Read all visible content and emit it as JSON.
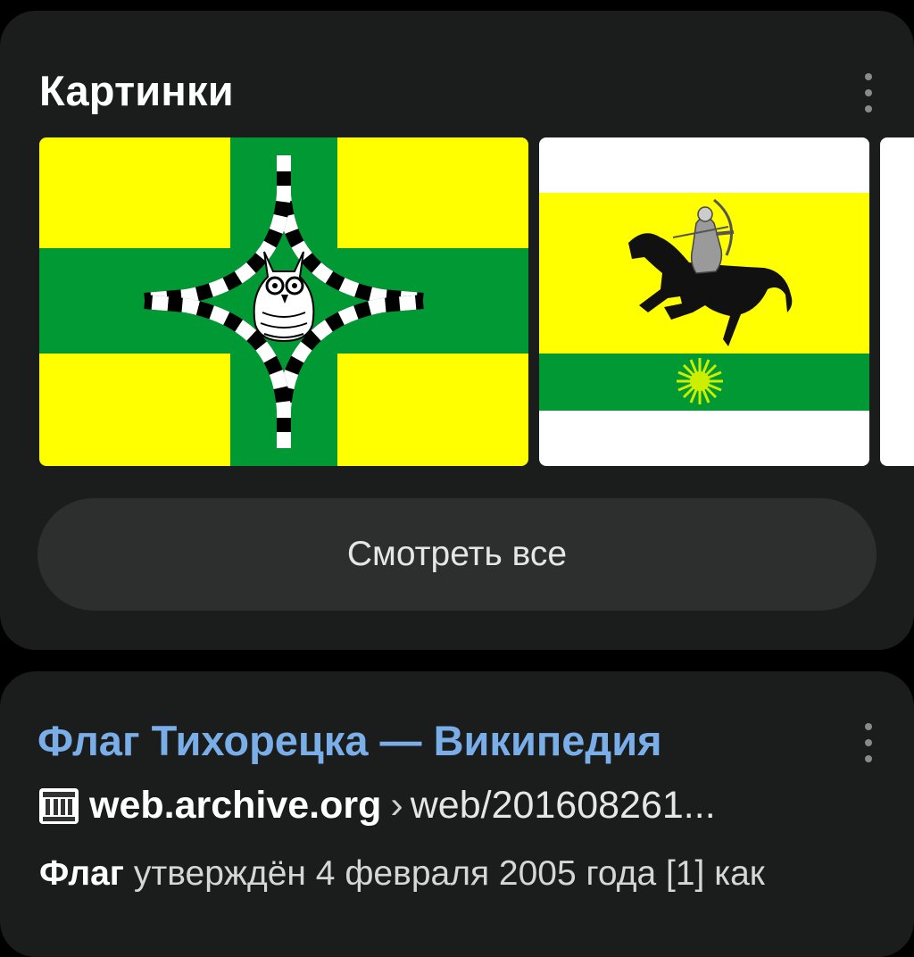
{
  "images_card": {
    "title": "Картинки",
    "see_all_label": "Смотреть все",
    "colors": {
      "card_bg": "#1b1c1c",
      "button_bg": "#2d2e2e",
      "flag_yellow": "#ffff00",
      "flag_green": "#009933"
    },
    "thumbnails": [
      {
        "icon": "tikhoretsk-district-flag-owl"
      },
      {
        "icon": "tikhoretsk-flag-horseman"
      },
      {
        "icon": "partial-thumbnail"
      }
    ]
  },
  "result_card": {
    "title": "Флаг Тихорецка — Википедия",
    "favicon": "archive-building-icon",
    "url_host": "web.archive.org",
    "url_separator": "›",
    "url_path": "web/201608261...",
    "snippet_bold": "Флаг",
    "snippet_text": "утверждён 4 февраля 2005 года [1] как",
    "colors": {
      "title_link": "#79aee8"
    }
  }
}
